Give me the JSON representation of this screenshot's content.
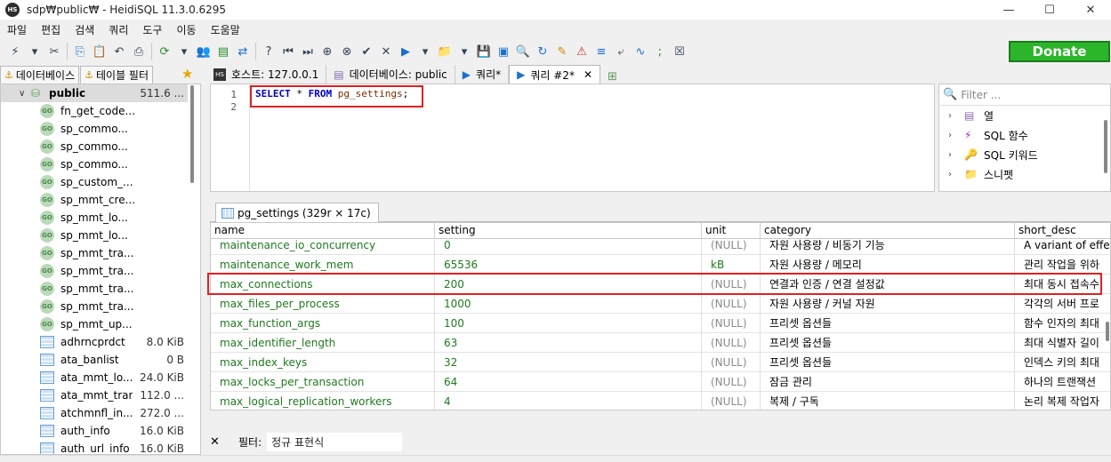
{
  "window": {
    "title": "sdp₩public₩ - HeidiSQL 11.3.0.6295",
    "app_icon_text": "HS",
    "minimize": "—",
    "maximize": "☐",
    "close": "✕"
  },
  "menu": [
    "파일",
    "편집",
    "검색",
    "쿼리",
    "도구",
    "이동",
    "도움말"
  ],
  "toolbar": {
    "donate_label": "Donate"
  },
  "left_tabs": {
    "database": "데이터베이스",
    "table_filter": "테이블 필터"
  },
  "tree": {
    "root": {
      "label": "public",
      "size": "511.6 ..."
    },
    "routines": [
      "fn_get_code...",
      "sp_commo...",
      "sp_commo...",
      "sp_commo...",
      "sp_custom_...",
      "sp_mmt_cre...",
      "sp_mmt_lo...",
      "sp_mmt_lo...",
      "sp_mmt_tra...",
      "sp_mmt_tra...",
      "sp_mmt_tra...",
      "sp_mmt_tra...",
      "sp_mmt_up..."
    ],
    "tables": [
      {
        "label": "adhrncprdct",
        "size": "8.0 KiB"
      },
      {
        "label": "ata_banlist",
        "size": "0 B"
      },
      {
        "label": "ata_mmt_lo...",
        "size": "24.0 KiB"
      },
      {
        "label": "ata_mmt_tran",
        "size": "112.0 ..."
      },
      {
        "label": "atchmnfl_in...",
        "size": "272.0 ..."
      },
      {
        "label": "auth_info",
        "size": "16.0 KiB"
      },
      {
        "label": "auth_url_info",
        "size": "16.0 KiB"
      }
    ]
  },
  "tabs": {
    "host": "호스트: 127.0.0.1",
    "database": "데이터베이스: public",
    "query1": "쿼리*",
    "query2": "쿼리 #2*"
  },
  "editor": {
    "line1": "1",
    "line2": "2",
    "kw_select": "SELECT",
    "star": " * ",
    "kw_from": "FROM",
    "table": "pg_settings",
    "semicolon": ";"
  },
  "side_panel": {
    "filter_placeholder": "Filter ...",
    "items": [
      "열",
      "SQL 함수",
      "SQL 키워드",
      "스니펫"
    ]
  },
  "result": {
    "tab_label": "pg_settings (329r × 17c)",
    "columns": [
      "name",
      "setting",
      "unit",
      "category",
      "short_desc"
    ],
    "rows": [
      [
        "maintenance_io_concurrency",
        "0",
        "(NULL)",
        "자원 사용량 / 비동기 기능",
        "A variant of effe"
      ],
      [
        "maintenance_work_mem",
        "65536",
        "kB",
        "자원 사용량 / 메모리",
        "관리 작업을 위하"
      ],
      [
        "max_connections",
        "200",
        "(NULL)",
        "연결과 인증 / 연결 설정값",
        "최대 동시 접속수"
      ],
      [
        "max_files_per_process",
        "1000",
        "(NULL)",
        "자원 사용량 / 커널 자원",
        "각각의 서버 프로"
      ],
      [
        "max_function_args",
        "100",
        "(NULL)",
        "프리셋 옵션들",
        "함수 인자의 최대"
      ],
      [
        "max_identifier_length",
        "63",
        "(NULL)",
        "프리셋 옵션들",
        "최대 식별자 길이"
      ],
      [
        "max_index_keys",
        "32",
        "(NULL)",
        "프리셋 옵션들",
        "인덱스 키의 최대"
      ],
      [
        "max_locks_per_transaction",
        "64",
        "(NULL)",
        "잠금 관리",
        "하나의 트랜잭션"
      ],
      [
        "max_logical_replication_workers",
        "4",
        "(NULL)",
        "복제 / 구독",
        "논리 복제 작업자"
      ]
    ]
  },
  "filter_bar": {
    "close": "✕",
    "label": "필터:",
    "placeholder": "정규 표현식"
  },
  "colors": {
    "highlight": "#e02020",
    "donate": "#2bb52b",
    "green_text": "#1f7a1f"
  }
}
